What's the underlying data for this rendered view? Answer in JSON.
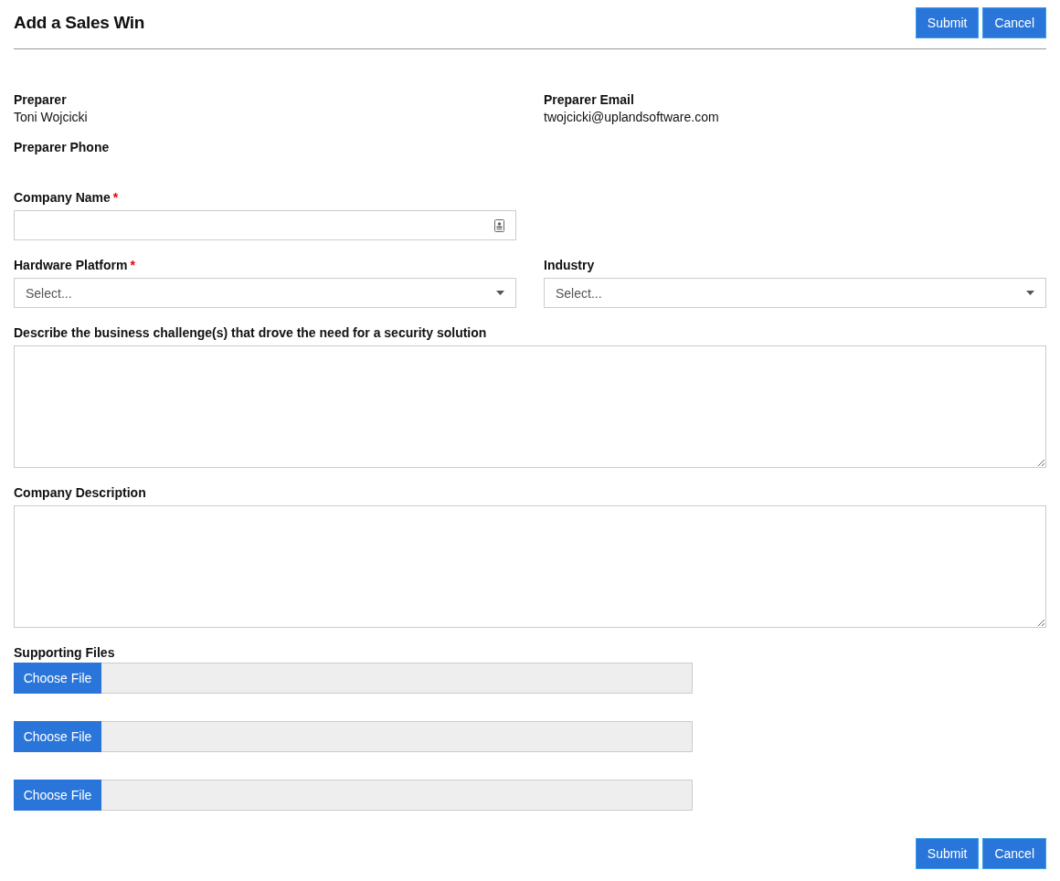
{
  "header": {
    "title": "Add a Sales Win",
    "buttons": [
      "Submit",
      "Cancel"
    ]
  },
  "preparer_info": [
    {
      "label": "Preparer",
      "value": "Toni Wojcicki"
    },
    {
      "label": "Preparer Email",
      "value": "twojcicki@uplandsoftware.com"
    },
    {
      "label": "Preparer Phone"
    }
  ],
  "rows": [
    [
      {
        "kind": "text",
        "label": "Company Name",
        "required_mark": "*"
      }
    ],
    [
      {
        "kind": "select",
        "label": "Hardware Platform",
        "required_mark": "*",
        "placeholder": "Select..."
      },
      {
        "kind": "select",
        "label": "Industry",
        "placeholder": "Select..."
      }
    ],
    [
      {
        "kind": "textarea",
        "label": "Describe the business challenge(s) that drove the need for a security solution"
      }
    ],
    [
      {
        "kind": "textarea",
        "label": "Company Description"
      }
    ]
  ],
  "supporting_files": {
    "label": "Supporting Files",
    "files": [
      {
        "button": "Choose File"
      },
      {
        "button": "Choose File"
      },
      {
        "button": "Choose File"
      }
    ]
  },
  "footer": {
    "buttons": [
      "Submit",
      "Cancel"
    ]
  }
}
